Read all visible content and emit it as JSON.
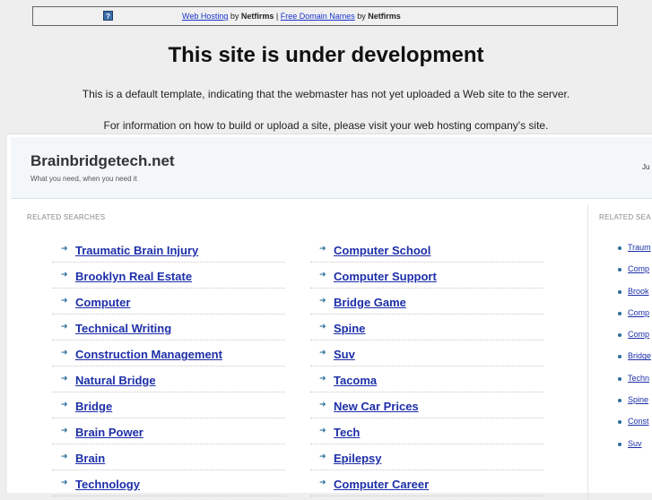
{
  "topbar": {
    "icon": "question-icon",
    "link1": "Web Hosting",
    "by1": " by ",
    "brand1": "Netfirms",
    "sep": " | ",
    "link2": "Free Domain Names",
    "by2": " by ",
    "brand2": "Netfirms"
  },
  "headline": "This site is under development",
  "message1": "This is a default template, indicating that the webmaster has not yet uploaded a Web site to the server.",
  "message2": "For information on how to build or upload a site, please visit your web hosting company's site.",
  "panel": {
    "domain": "Brainbridgetech.net",
    "tagline": "What you need, when you need it",
    "corner_text": "Ju",
    "related_label": "RELATED SEARCHES",
    "related_label_right": "RELATED SEA",
    "left_links": [
      "Traumatic Brain Injury",
      "Brooklyn Real Estate",
      "Computer",
      "Technical Writing",
      "Construction Management",
      "Natural Bridge",
      "Bridge",
      "Brain Power",
      "Brain",
      "Technology"
    ],
    "right_links": [
      "Computer School",
      "Computer Support",
      "Bridge Game",
      "Spine",
      "Suv",
      "Tacoma",
      "New Car Prices",
      "Tech",
      "Epilepsy",
      "Computer Career"
    ],
    "side_links": [
      "Traum",
      "Comp",
      "Brook",
      "Comp",
      "Comp",
      "Bridge",
      "Techn",
      "Spine",
      "Const",
      "Suv"
    ]
  }
}
